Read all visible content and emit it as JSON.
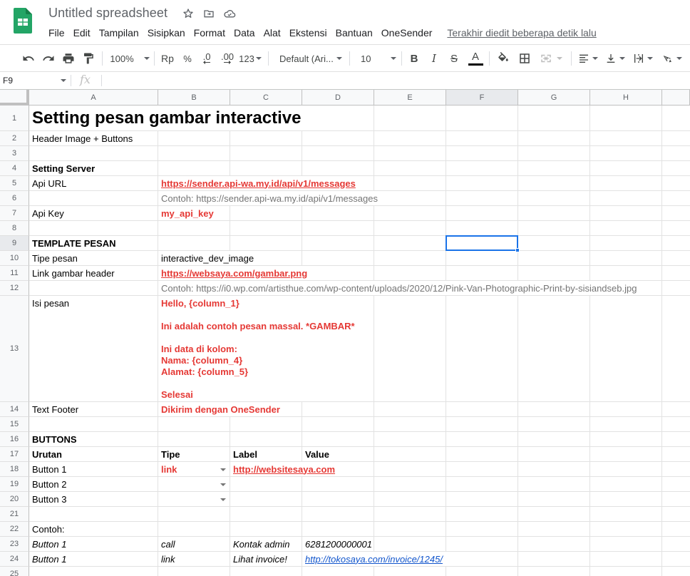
{
  "app": {
    "doc_title": "Untitled spreadsheet",
    "title_icons": [
      "star-icon",
      "move-to-folder-icon",
      "cloud-status-icon"
    ],
    "menu": [
      "File",
      "Edit",
      "Tampilan",
      "Sisipkan",
      "Format",
      "Data",
      "Alat",
      "Ekstensi",
      "Bantuan",
      "OneSender"
    ],
    "last_edit": "Terakhir diedit beberapa detik lalu"
  },
  "toolbar": {
    "zoom": "100%",
    "currency": "Rp",
    "percent": "%",
    "decrease_decimal": ".0",
    "increase_decimal": ".00",
    "number_format": "123",
    "font": "Default (Ari...",
    "font_size": "10",
    "bold": "B",
    "italic": "I",
    "strike": "S",
    "text_color_label": "A",
    "text_color": "#000000"
  },
  "formula_bar": {
    "cell_ref": "F9",
    "fx": "fx",
    "value": ""
  },
  "columns": [
    "A",
    "B",
    "C",
    "D",
    "E",
    "F",
    "G",
    "H"
  ],
  "rows": [
    "1",
    "2",
    "3",
    "4",
    "5",
    "6",
    "7",
    "8",
    "9",
    "10",
    "11",
    "12",
    "13",
    "14",
    "15",
    "16",
    "17",
    "18",
    "19",
    "20",
    "21",
    "22",
    "23",
    "24",
    "25"
  ],
  "selected_cell": "F9",
  "cells": {
    "A1": "Setting pesan gambar interactive",
    "A2": "Header Image + Buttons",
    "A4": "Setting Server",
    "A5": "Api URL",
    "B5": "https://sender.api-wa.my.id/api/v1/messages",
    "B6": "Contoh: https://sender.api-wa.my.id/api/v1/messages",
    "A7": "Api Key",
    "B7": "my_api_key",
    "A9": "TEMPLATE PESAN",
    "A10": "Tipe pesan",
    "B10": "interactive_dev_image",
    "A11": "Link gambar header",
    "B11": "https://websaya.com/gambar.png",
    "B12": "Contoh: https://i0.wp.com/artisthue.com/wp-content/uploads/2020/12/Pink-Van-Photographic-Print-by-sisiandseb.jpg",
    "A13": "Isi pesan",
    "B13": "Hello, {column_1}\n\nIni adalah contoh pesan massal. *GAMBAR*\n\nIni data di kolom:\nNama: {column_4}\nAlamat: {column_5}\n\nSelesai",
    "A14": "Text Footer",
    "B14": "Dikirim dengan OneSender",
    "A16": "BUTTONS",
    "A17": "Urutan",
    "B17": "Tipe",
    "C17": "Label",
    "D17": "Value",
    "A18": "Button 1",
    "B18": "link",
    "C18": "http://websitesaya.com",
    "A19": "Button 2",
    "A20": "Button 3",
    "A22": "Contoh:",
    "A23": "Button 1",
    "B23": "call",
    "C23": "Kontak admin",
    "D23": "6281200000001",
    "A24": "Button 1",
    "B24": "link",
    "C24": "Lihat invoice!",
    "D24": "http://tokosaya.com/invoice/1245/"
  },
  "colors": {
    "accent_red": "#e53935",
    "link_blue": "#1155cc",
    "selection_blue": "#1a73e8",
    "sheets_green": "#0f9d58"
  }
}
